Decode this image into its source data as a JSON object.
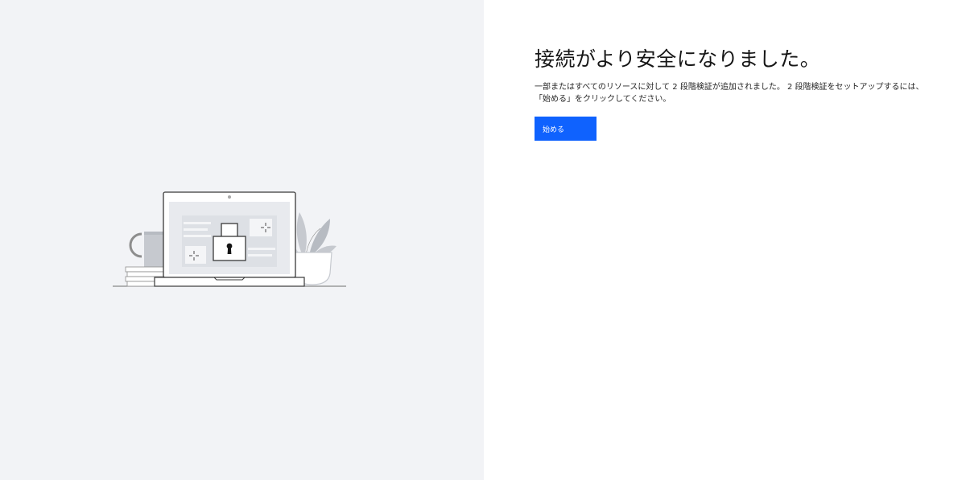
{
  "main": {
    "title": "接続がより安全になりました。",
    "description_line1": "一部またはすべてのリソースに対して 2 段階検証が追加されました。 2 段階検証をセットアップするには、",
    "description_line2": "「始める」をクリックしてください。",
    "start_button_label": "始める"
  },
  "illustration": {
    "icon": "laptop-lock-illustration"
  },
  "colors": {
    "left_background": "#f2f3f6",
    "right_background": "#ffffff",
    "button_primary": "#0f62fe",
    "button_text": "#ffffff"
  }
}
